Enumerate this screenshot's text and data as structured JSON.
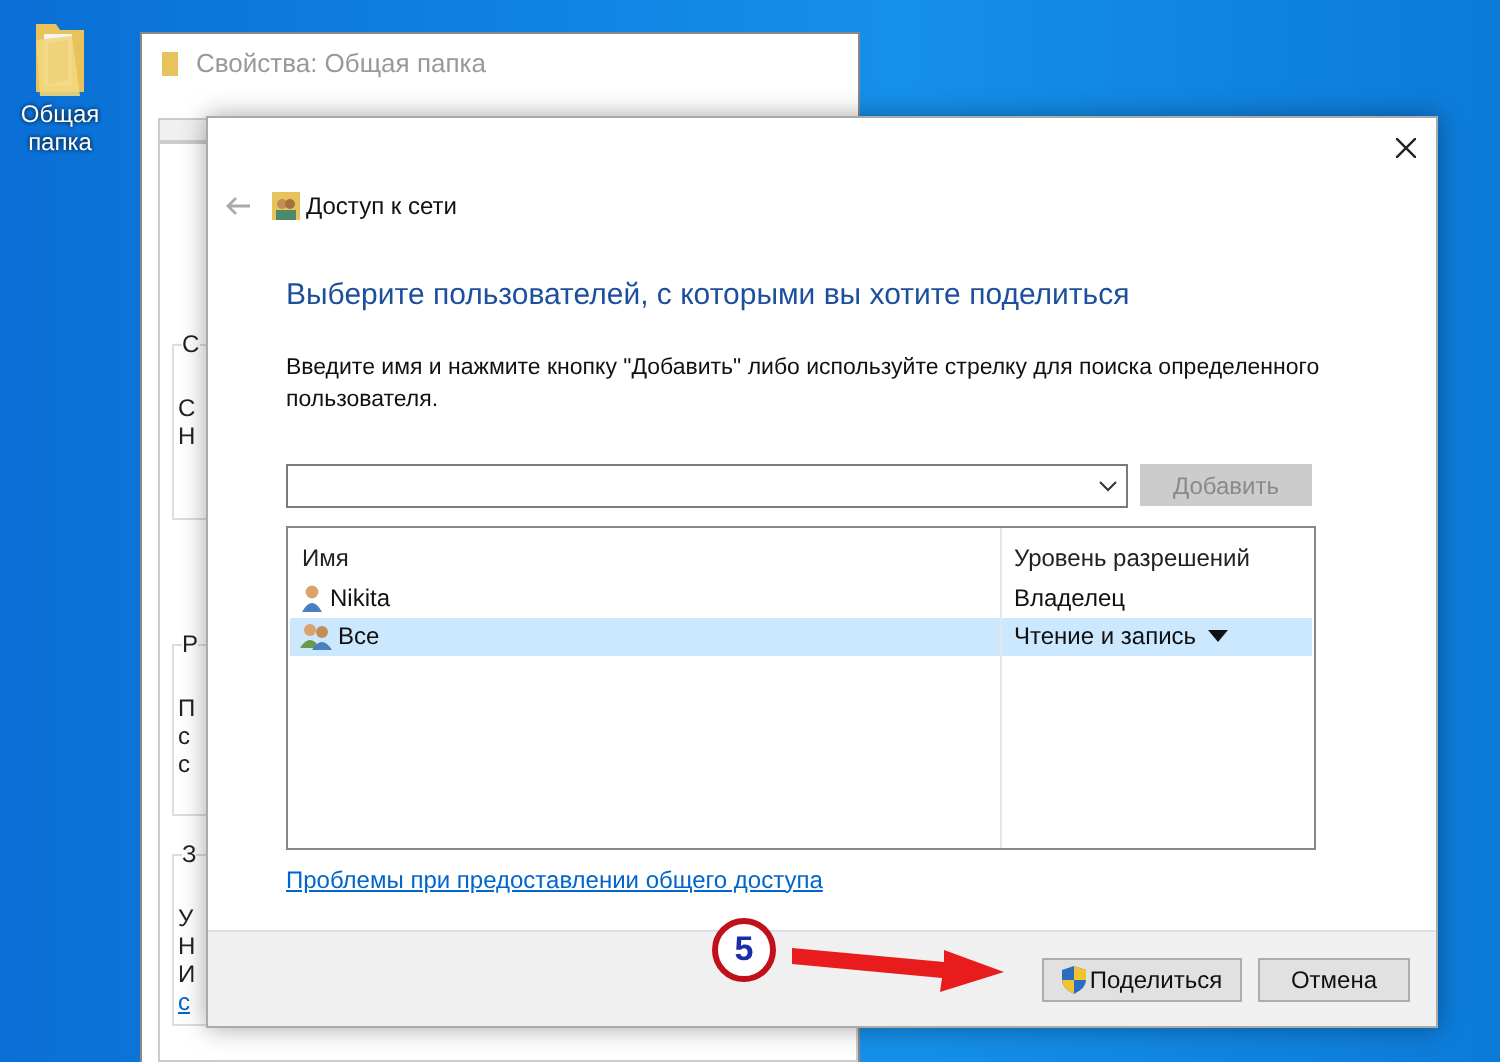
{
  "desktop_icon": {
    "label": "Общая папка"
  },
  "background_window": {
    "title": "Свойства: Общая папка",
    "groups": [
      {
        "title": "С",
        "lines": [
          "С",
          "Н"
        ]
      },
      {
        "title": "Р",
        "lines": [
          "П",
          "с",
          "с"
        ]
      },
      {
        "title": "З",
        "lines": [
          "У",
          "Н",
          "И"
        ],
        "link": "с"
      }
    ]
  },
  "dialog": {
    "nav_title": "Доступ к сети",
    "heading": "Выберите пользователей, с которыми вы хотите поделиться",
    "description": "Введите имя и нажмите кнопку \"Добавить\" либо используйте стрелку для поиска определенного пользователя.",
    "add_button": {
      "label": "Добавить",
      "disabled": true
    },
    "table": {
      "columns": [
        "Имя",
        "Уровень разрешений"
      ],
      "rows": [
        {
          "name": "Nikita",
          "kind": "user",
          "permission": "Владелец",
          "selected": false,
          "has_dropdown": false
        },
        {
          "name": "Все",
          "kind": "group",
          "permission": "Чтение и запись",
          "selected": true,
          "has_dropdown": true
        }
      ]
    },
    "help_link": "Проблемы при предоставлении общего доступа",
    "buttons": [
      {
        "label": "Поделиться",
        "kind": "shield"
      },
      {
        "label": "Отмена",
        "kind": "plain"
      }
    ]
  },
  "annotation": {
    "number": "5"
  }
}
